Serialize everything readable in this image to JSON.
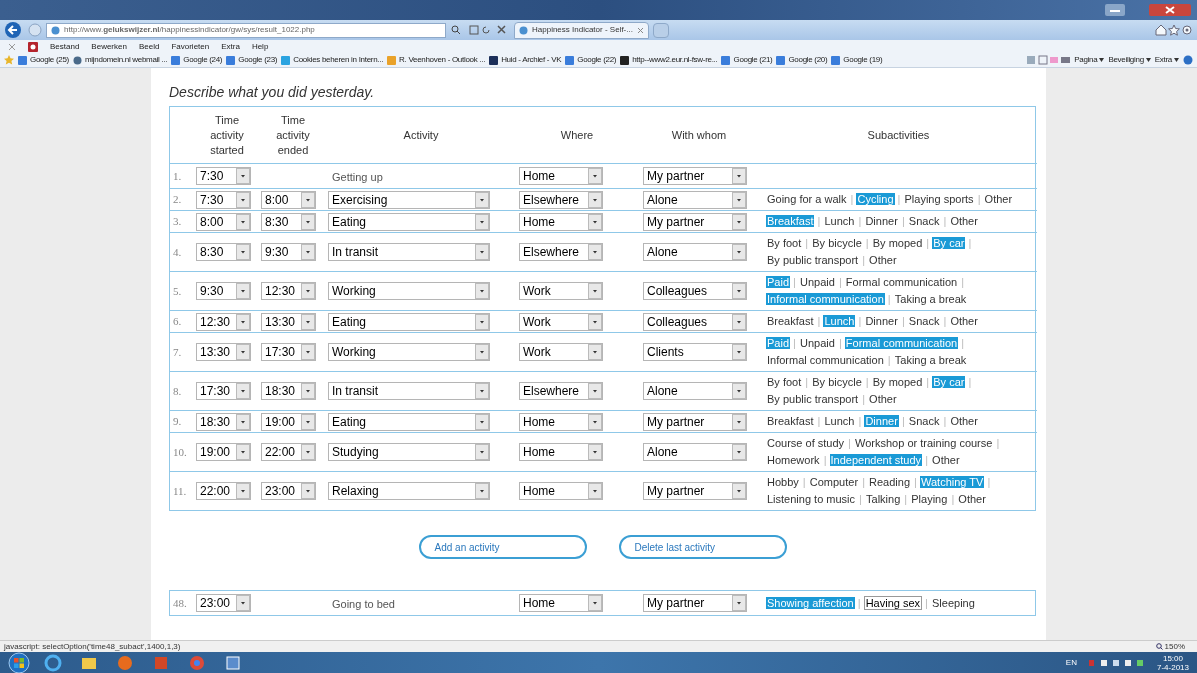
{
  "browser": {
    "address": "http://www.**gelukswijzer.nl**/happinessindicator/gw/sys/result_1022.php",
    "tab": "Happiness Indicator - Self-...",
    "menu": [
      "Bestand",
      "Bewerken",
      "Beeld",
      "Favorieten",
      "Extra",
      "Help"
    ],
    "favorites": [
      {
        "label": "Google (25)",
        "kind": "google"
      },
      {
        "label": "mijndomein.nl webmail ...",
        "kind": "mail"
      },
      {
        "label": "Google (24)",
        "kind": "google"
      },
      {
        "label": "Google (23)",
        "kind": "google"
      },
      {
        "label": "Cookies beheren in Intern...",
        "kind": "windows"
      },
      {
        "label": "R. Veenhoven - Outlook ...",
        "kind": "outlook"
      },
      {
        "label": "Huid - Archief - VK",
        "kind": "vk"
      },
      {
        "label": "Google (22)",
        "kind": "google"
      },
      {
        "label": "http--www2.eur.nl-fsw-re...",
        "kind": "page"
      },
      {
        "label": "Google (21)",
        "kind": "google"
      },
      {
        "label": "Google (20)",
        "kind": "google"
      },
      {
        "label": "Google (19)",
        "kind": "google"
      }
    ],
    "tools": [
      "Pagina",
      "Beveiliging",
      "Extra"
    ]
  },
  "page": {
    "instruction": "Describe what you did yesterday.",
    "columns": [
      "",
      "Time activity started",
      "Time activity ended",
      "Activity",
      "Where",
      "With whom",
      "Subactivities"
    ],
    "separator": "|",
    "rows": [
      {
        "number": "1.",
        "start": "7:30",
        "activity": "Getting up",
        "kind": "fixed",
        "where": "Home",
        "with_whom": "My partner",
        "subactivities": []
      },
      {
        "number": "2.",
        "start": "7:30",
        "end": "8:00",
        "activity": "Exercising",
        "kind": "editable",
        "where": "Elsewhere",
        "with_whom": "Alone",
        "subactivities": [
          {
            "label": "Going for a walk",
            "selected": false
          },
          {
            "label": "Cycling",
            "selected": true
          },
          {
            "label": "Playing sports",
            "selected": false
          },
          {
            "label": "Other",
            "selected": false
          }
        ]
      },
      {
        "number": "3.",
        "start": "8:00",
        "end": "8:30",
        "activity": "Eating",
        "kind": "editable",
        "where": "Home",
        "with_whom": "My partner",
        "subactivities": [
          {
            "label": "Breakfast",
            "selected": true
          },
          {
            "label": "Lunch",
            "selected": false
          },
          {
            "label": "Dinner",
            "selected": false
          },
          {
            "label": "Snack",
            "selected": false
          },
          {
            "label": "Other",
            "selected": false
          }
        ]
      },
      {
        "number": "4.",
        "start": "8:30",
        "end": "9:30",
        "activity": "In transit",
        "kind": "editable",
        "where": "Elsewhere",
        "with_whom": "Alone",
        "subactivities": [
          {
            "label": "By foot",
            "selected": false
          },
          {
            "label": "By bicycle",
            "selected": false
          },
          {
            "label": "By moped",
            "selected": false
          },
          {
            "label": "By car",
            "selected": true
          },
          {
            "label": "By public transport",
            "selected": false
          },
          {
            "label": "Other",
            "selected": false
          }
        ]
      },
      {
        "number": "5.",
        "start": "9:30",
        "end": "12:30",
        "activity": "Working",
        "kind": "editable",
        "where": "Work",
        "with_whom": "Colleagues",
        "subactivities": [
          {
            "label": "Paid",
            "selected": true
          },
          {
            "label": "Unpaid",
            "selected": false
          },
          {
            "label": "Formal communication",
            "selected": false
          },
          {
            "label": "Informal communication",
            "selected": true
          },
          {
            "label": "Taking a break",
            "selected": false
          }
        ]
      },
      {
        "number": "6.",
        "start": "12:30",
        "end": "13:30",
        "activity": "Eating",
        "kind": "editable",
        "where": "Work",
        "with_whom": "Colleagues",
        "subactivities": [
          {
            "label": "Breakfast",
            "selected": false
          },
          {
            "label": "Lunch",
            "selected": true
          },
          {
            "label": "Dinner",
            "selected": false
          },
          {
            "label": "Snack",
            "selected": false
          },
          {
            "label": "Other",
            "selected": false
          }
        ]
      },
      {
        "number": "7.",
        "start": "13:30",
        "end": "17:30",
        "activity": "Working",
        "kind": "editable",
        "where": "Work",
        "with_whom": "Clients",
        "subactivities": [
          {
            "label": "Paid",
            "selected": true
          },
          {
            "label": "Unpaid",
            "selected": false
          },
          {
            "label": "Formal communication",
            "selected": true
          },
          {
            "label": "Informal communication",
            "selected": false
          },
          {
            "label": "Taking a break",
            "selected": false
          }
        ]
      },
      {
        "number": "8.",
        "start": "17:30",
        "end": "18:30",
        "activity": "In transit",
        "kind": "editable",
        "where": "Elsewhere",
        "with_whom": "Alone",
        "subactivities": [
          {
            "label": "By foot",
            "selected": false
          },
          {
            "label": "By bicycle",
            "selected": false
          },
          {
            "label": "By moped",
            "selected": false
          },
          {
            "label": "By car",
            "selected": true
          },
          {
            "label": "By public transport",
            "selected": false
          },
          {
            "label": "Other",
            "selected": false
          }
        ]
      },
      {
        "number": "9.",
        "start": "18:30",
        "end": "19:00",
        "activity": "Eating",
        "kind": "editable",
        "where": "Home",
        "with_whom": "My partner",
        "subactivities": [
          {
            "label": "Breakfast",
            "selected": false
          },
          {
            "label": "Lunch",
            "selected": false
          },
          {
            "label": "Dinner",
            "selected": true
          },
          {
            "label": "Snack",
            "selected": false
          },
          {
            "label": "Other",
            "selected": false
          }
        ]
      },
      {
        "number": "10.",
        "start": "19:00",
        "end": "22:00",
        "activity": "Studying",
        "kind": "editable",
        "where": "Home",
        "with_whom": "Alone",
        "subactivities": [
          {
            "label": "Course of study",
            "selected": false
          },
          {
            "label": "Workshop or training course",
            "selected": false
          },
          {
            "label": "Homework",
            "selected": false
          },
          {
            "label": "Independent study",
            "selected": true
          },
          {
            "label": "Other",
            "selected": false
          }
        ]
      },
      {
        "number": "11.",
        "start": "22:00",
        "end": "23:00",
        "activity": "Relaxing",
        "kind": "editable",
        "where": "Home",
        "with_whom": "My partner",
        "subactivities": [
          {
            "label": "Hobby",
            "selected": false
          },
          {
            "label": "Computer",
            "selected": false
          },
          {
            "label": "Reading",
            "selected": false
          },
          {
            "label": "Watching TV",
            "selected": true
          },
          {
            "label": "Listening to music",
            "selected": false
          },
          {
            "label": "Talking",
            "selected": false
          },
          {
            "label": "Playing",
            "selected": false
          },
          {
            "label": "Other",
            "selected": false
          }
        ]
      }
    ],
    "buttons": [
      "Add an activity",
      "Delete last activity"
    ],
    "last_rows": [
      {
        "number": "48.",
        "start": "23:00",
        "activity": "Going to bed",
        "kind": "fixed",
        "where": "Home",
        "with_whom": "My partner",
        "subactivities": [
          {
            "label": "Showing affection",
            "selected": true,
            "hovered": false
          },
          {
            "label": "Having sex",
            "selected": false,
            "hovered": true
          },
          {
            "label": "Sleeping",
            "selected": false,
            "hovered": false
          }
        ]
      }
    ]
  },
  "status_bar": {
    "text": "javascript: selectOption('time48_subact',1400,1,3)",
    "zoom": "150%"
  },
  "taskbar": {
    "language": "EN",
    "time": "15:00",
    "date": "7-4-2013"
  }
}
